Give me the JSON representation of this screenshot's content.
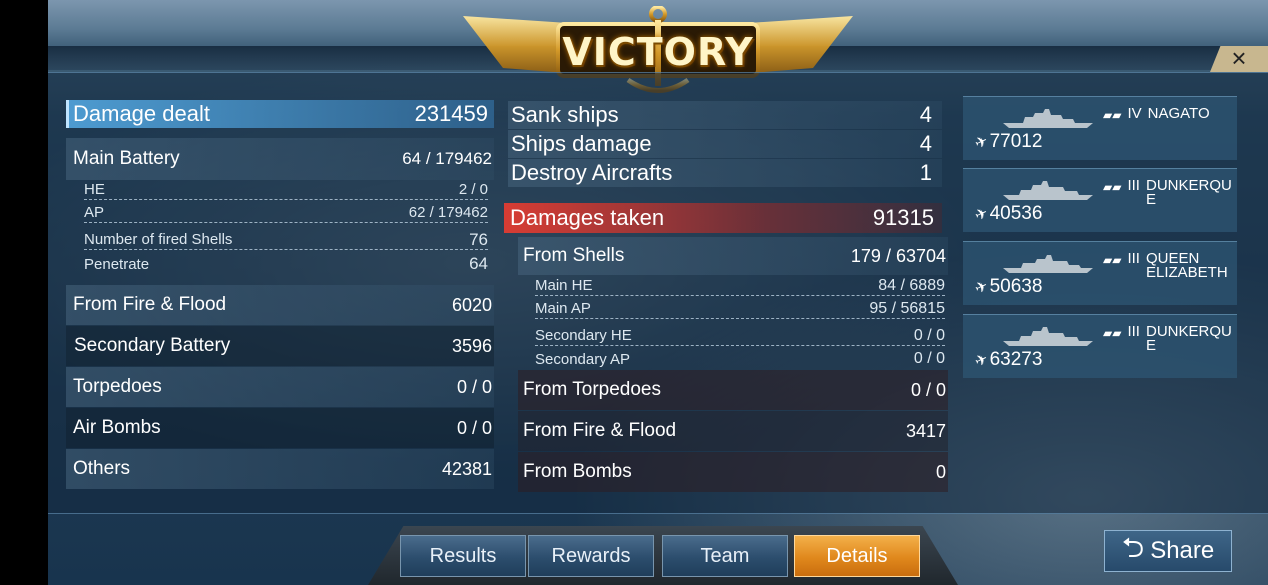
{
  "banner": {
    "title": "VICTORY",
    "close": "×"
  },
  "damage_dealt": {
    "label": "Damage dealt",
    "value": "231459",
    "main_battery": {
      "label": "Main Battery",
      "value": "64 / 179462"
    },
    "sub": [
      {
        "label": "HE",
        "value": "2 / 0"
      },
      {
        "label": "AP",
        "value": "62 / 179462"
      },
      {
        "label": "Number of fired Shells",
        "value": "76"
      },
      {
        "label": "Penetrate",
        "value": "64"
      }
    ],
    "rows": [
      {
        "label": "From Fire & Flood",
        "value": "6020"
      },
      {
        "label": "Secondary Battery",
        "value": "3596"
      },
      {
        "label": "Torpedoes",
        "value": "0 / 0"
      },
      {
        "label": "Air Bombs",
        "value": "0 / 0"
      },
      {
        "label": "Others",
        "value": "42381"
      }
    ]
  },
  "kills": [
    {
      "label": "Sank ships",
      "value": "4"
    },
    {
      "label": "Ships damage",
      "value": "4"
    },
    {
      "label": "Destroy Aircrafts",
      "value": "1"
    }
  ],
  "damages_taken": {
    "label": "Damages taken",
    "value": "91315",
    "from_shells": {
      "label": "From Shells",
      "value": "179 / 63704"
    },
    "sub": [
      {
        "label": "Main HE",
        "value": "84 / 6889"
      },
      {
        "label": "Main AP",
        "value": "95 / 56815"
      },
      {
        "label": "Secondary HE",
        "value": "0 / 0"
      },
      {
        "label": "Secondary AP",
        "value": "0 / 0"
      }
    ],
    "rows": [
      {
        "label": "From Torpedoes",
        "value": "0 / 0"
      },
      {
        "label": "From Fire & Flood",
        "value": "3417"
      },
      {
        "label": "From Bombs",
        "value": "0"
      }
    ]
  },
  "ships": [
    {
      "tier": "IV",
      "name": "NAGATO",
      "score": "77012"
    },
    {
      "tier": "III",
      "name": "DUNKERQUE",
      "score": "40536"
    },
    {
      "tier": "III",
      "name": "QUEEN ELIZABETH",
      "score": "50638"
    },
    {
      "tier": "III",
      "name": "DUNKERQUE",
      "score": "63273"
    }
  ],
  "tabs": [
    "Results",
    "Rewards",
    "Team",
    "Details"
  ],
  "active_tab": "Details",
  "share": {
    "label": "Share"
  },
  "colors": {
    "accent": "#e0881c",
    "highlight_blue": "#50a0d7",
    "damage_red": "#e13c32"
  }
}
